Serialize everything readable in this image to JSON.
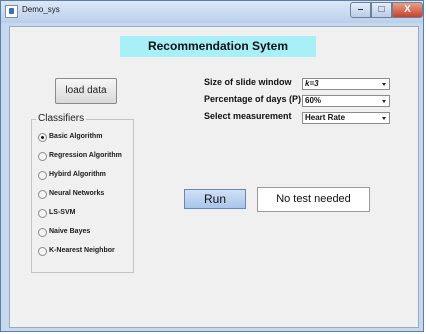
{
  "window": {
    "title": "Demo_sys",
    "min_glyph": "–",
    "max_glyph": "□",
    "close_glyph": "X"
  },
  "header": {
    "title": "Recommendation Sytem"
  },
  "load_button": {
    "label": "load data"
  },
  "classifiers": {
    "label": "Classifiers",
    "selected": "Basic Algorithm",
    "options": [
      "Basic Algorithm",
      "Regression Algorithm",
      "Hybird Algorithm",
      "Neural Networks",
      "LS-SVM",
      "Naive Bayes",
      "K-Nearest Neighbor"
    ]
  },
  "settings": {
    "window_label": "Size of slide window",
    "window_value": "k=3",
    "percentage_label": "Percentage of days (P)",
    "percentage_value": "60%",
    "measurement_label": "Select measurement",
    "measurement_value": "Heart Rate"
  },
  "run_button": {
    "label": "Run"
  },
  "status": {
    "text": "No test needed"
  }
}
